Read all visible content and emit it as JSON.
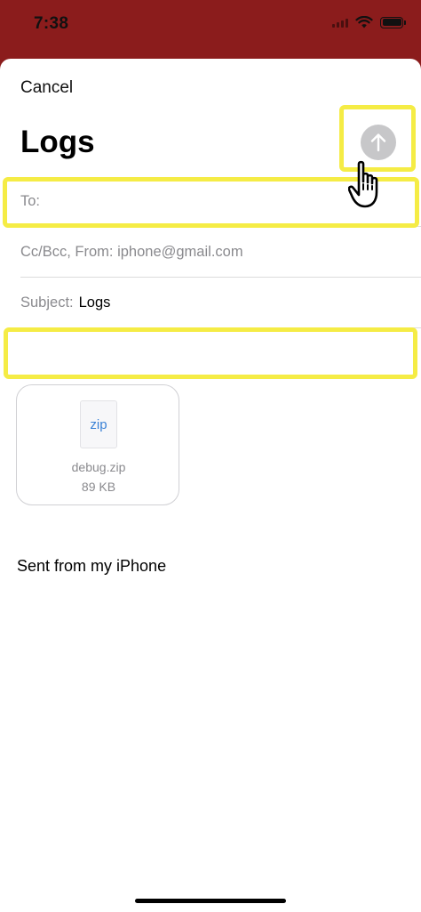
{
  "status_bar": {
    "time": "7:38",
    "icons": [
      "cellular-signal-icon",
      "wifi-icon",
      "battery-icon"
    ]
  },
  "compose": {
    "cancel_label": "Cancel",
    "title": "Logs",
    "send_icon": "arrow-up-icon",
    "to_label": "To:",
    "to_value": "",
    "cc_bcc_from_label": "Cc/Bcc, From: iphone@gmail.com",
    "subject_label": "Subject:",
    "subject_value": "Logs",
    "body_value": ""
  },
  "attachment": {
    "icon_text": "zip",
    "file_name": "debug.zip",
    "file_size": "89 KB"
  },
  "signature": "Sent from my iPhone",
  "colors": {
    "status_bar_background": "#8b1c1c",
    "highlight": "#f5ec45",
    "send_button_disabled": "#c7c7c9",
    "zip_icon_text": "#3b82d6",
    "secondary_label": "#8a8a8e"
  }
}
